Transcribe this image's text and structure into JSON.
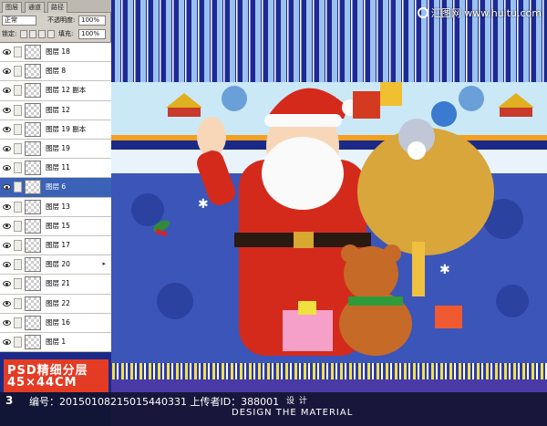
{
  "panel": {
    "tabs": [
      "图层",
      "通道",
      "路径"
    ],
    "blend_mode": "正常",
    "opacity_label": "不透明度:",
    "opacity_value": "100%",
    "lock_label": "锁定:",
    "fill_label": "填充:",
    "fill_value": "100%",
    "layers": [
      {
        "name": "图层 18",
        "selected": false
      },
      {
        "name": "图层 8",
        "selected": false
      },
      {
        "name": "图层 12 副本",
        "selected": false
      },
      {
        "name": "图层 12",
        "selected": false
      },
      {
        "name": "图层 19 副本",
        "selected": false
      },
      {
        "name": "图层 19",
        "selected": false
      },
      {
        "name": "图层 11",
        "selected": false
      },
      {
        "name": "图层 6",
        "selected": true
      },
      {
        "name": "图层 13",
        "selected": false
      },
      {
        "name": "图层 15",
        "selected": false
      },
      {
        "name": "图层 17",
        "selected": false
      },
      {
        "name": "图层 20",
        "selected": false,
        "fx": true
      },
      {
        "name": "图层 21",
        "selected": false
      },
      {
        "name": "图层 22",
        "selected": false
      },
      {
        "name": "图层 16",
        "selected": false
      },
      {
        "name": "图层 1",
        "selected": false
      }
    ]
  },
  "watermark": {
    "text": "汇图网 www.huitu.com"
  },
  "badge": {
    "line1": "PSD精细分层",
    "line2": "45×44CM"
  },
  "footer": {
    "format_note": "3",
    "meta": "编号：20150108215015440331 上传者ID：388001",
    "design_caption": "设 计",
    "brand_sub": "DESIGN THE MATERIAL"
  },
  "colors": {
    "stripe_dark": "#1d2a93",
    "stripe_light": "#9bc2ef",
    "band_light": "#cbe8f7",
    "bg_blue": "#3b55b9",
    "santa_red": "#d42a1c",
    "badge_red": "#e43b24"
  }
}
